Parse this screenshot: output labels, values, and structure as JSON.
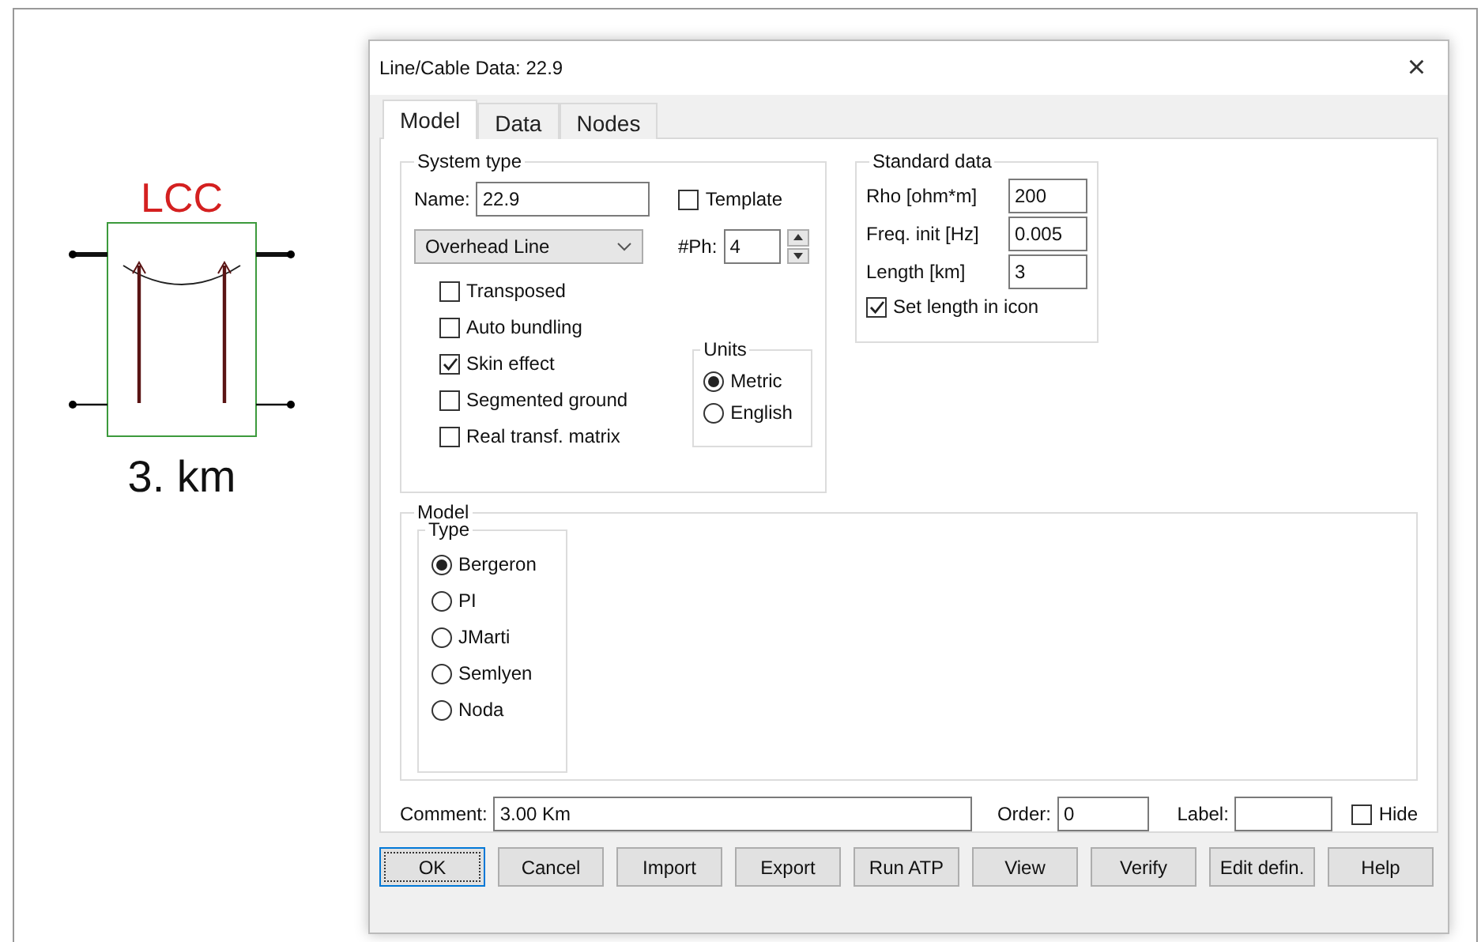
{
  "canvas": {
    "component": {
      "label": "LCC",
      "length": "3. km"
    }
  },
  "dialog": {
    "title": "Line/Cable Data: 22.9",
    "close": "×",
    "tabs": [
      {
        "label": "Model",
        "selected": true
      },
      {
        "label": "Data",
        "selected": false
      },
      {
        "label": "Nodes",
        "selected": false
      }
    ],
    "system_type": {
      "title": "System type",
      "name_label": "Name:",
      "name_value": "22.9",
      "template": {
        "label": "Template",
        "checked": false
      },
      "line_type": "Overhead Line",
      "phases_label": "#Ph:",
      "phases_value": "4",
      "options": [
        {
          "label": "Transposed",
          "checked": false
        },
        {
          "label": "Auto bundling",
          "checked": false
        },
        {
          "label": "Skin effect",
          "checked": true
        },
        {
          "label": "Segmented ground",
          "checked": false
        },
        {
          "label": "Real transf. matrix",
          "checked": false
        }
      ],
      "units": {
        "title": "Units",
        "options": [
          {
            "label": "Metric",
            "selected": true
          },
          {
            "label": "English",
            "selected": false
          }
        ]
      }
    },
    "standard_data": {
      "title": "Standard data",
      "fields": [
        {
          "label": "Rho [ohm*m]",
          "value": "200"
        },
        {
          "label": "Freq. init [Hz]",
          "value": "0.005"
        },
        {
          "label": "Length [km]",
          "value": "3"
        }
      ],
      "set_length": {
        "label": "Set length in icon",
        "checked": true
      }
    },
    "model": {
      "title": "Model",
      "type": {
        "title": "Type",
        "options": [
          {
            "label": "Bergeron",
            "selected": true
          },
          {
            "label": "PI",
            "selected": false
          },
          {
            "label": "JMarti",
            "selected": false
          },
          {
            "label": "Semlyen",
            "selected": false
          },
          {
            "label": "Noda",
            "selected": false
          }
        ]
      }
    },
    "comment": {
      "label": "Comment:",
      "value": "3.00 Km"
    },
    "order": {
      "label": "Order:",
      "value": "0"
    },
    "label_field": {
      "label": "Label:"
    },
    "hide": {
      "label": "Hide",
      "checked": false
    },
    "buttons": [
      {
        "label": "OK",
        "default": true
      },
      {
        "label": "Cancel",
        "default": false
      },
      {
        "label": "Import",
        "default": false
      },
      {
        "label": "Export",
        "default": false
      },
      {
        "label": "Run ATP",
        "default": false
      },
      {
        "label": "View",
        "default": false
      },
      {
        "label": "Verify",
        "default": false
      },
      {
        "label": "Edit defin.",
        "default": false
      },
      {
        "label": "Help",
        "default": false
      }
    ]
  }
}
